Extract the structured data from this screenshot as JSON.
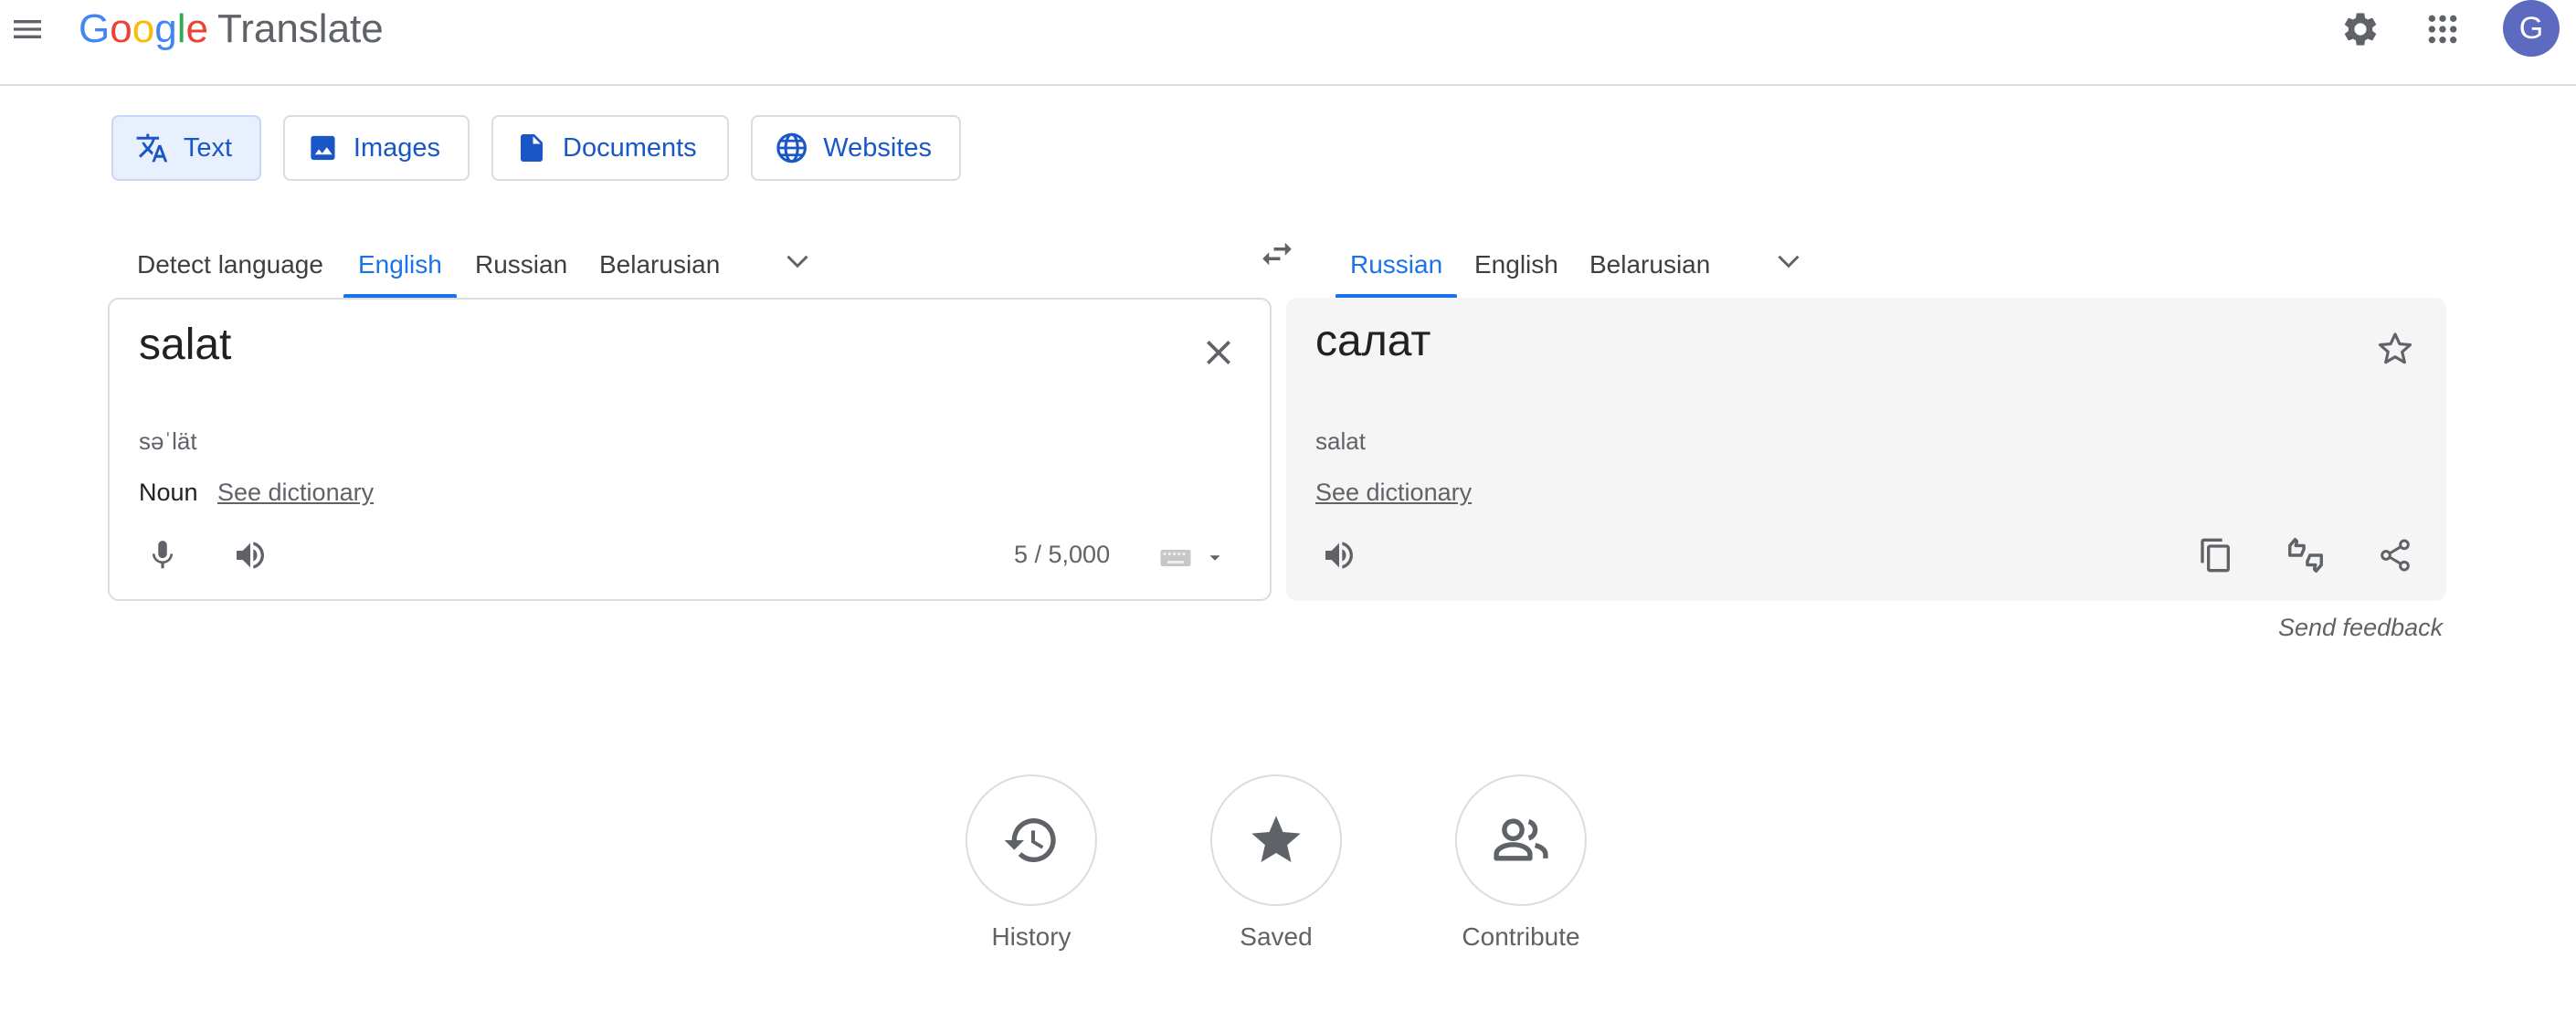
{
  "header": {
    "logo_parts": [
      "G",
      "o",
      "o",
      "g",
      "l",
      "e"
    ],
    "product_name": "Translate",
    "avatar_letter": "G",
    "icons": {
      "menu": "menu-icon",
      "settings": "gear-icon",
      "apps": "apps-grid-icon"
    }
  },
  "modes": [
    {
      "label": "Text",
      "icon": "translate-icon",
      "active": true
    },
    {
      "label": "Images",
      "icon": "image-icon",
      "active": false
    },
    {
      "label": "Documents",
      "icon": "document-icon",
      "active": false
    },
    {
      "label": "Websites",
      "icon": "globe-icon",
      "active": false
    }
  ],
  "source_languages": {
    "tabs": [
      "Detect language",
      "English",
      "Russian",
      "Belarusian"
    ],
    "active": "English"
  },
  "target_languages": {
    "tabs": [
      "Russian",
      "English",
      "Belarusian"
    ],
    "active": "Russian"
  },
  "source": {
    "text": "salat",
    "transliteration": "səˈlät",
    "part_of_speech": "Noun",
    "dictionary_link": "See dictionary",
    "char_count": "5 / 5,000"
  },
  "target": {
    "text": "салат",
    "transliteration": "salat",
    "dictionary_link": "See dictionary"
  },
  "feedback_label": "Send feedback",
  "actions": [
    {
      "label": "History",
      "icon": "history-icon"
    },
    {
      "label": "Saved",
      "icon": "star-icon"
    },
    {
      "label": "Contribute",
      "icon": "people-icon"
    }
  ],
  "colors": {
    "accent": "#1a73e8",
    "avatar": "#5c6bc0",
    "target_panel_bg": "#f5f5f5"
  }
}
